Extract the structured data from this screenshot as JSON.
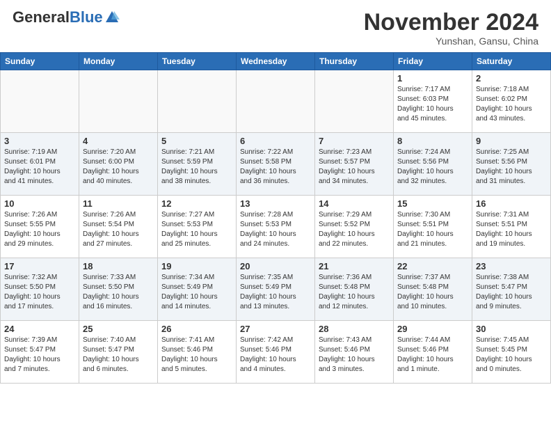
{
  "header": {
    "logo_general": "General",
    "logo_blue": "Blue",
    "month_title": "November 2024",
    "location": "Yunshan, Gansu, China"
  },
  "days_of_week": [
    "Sunday",
    "Monday",
    "Tuesday",
    "Wednesday",
    "Thursday",
    "Friday",
    "Saturday"
  ],
  "weeks": [
    {
      "shaded": false,
      "days": [
        {
          "date": "",
          "info": ""
        },
        {
          "date": "",
          "info": ""
        },
        {
          "date": "",
          "info": ""
        },
        {
          "date": "",
          "info": ""
        },
        {
          "date": "",
          "info": ""
        },
        {
          "date": "1",
          "info": "Sunrise: 7:17 AM\nSunset: 6:03 PM\nDaylight: 10 hours\nand 45 minutes."
        },
        {
          "date": "2",
          "info": "Sunrise: 7:18 AM\nSunset: 6:02 PM\nDaylight: 10 hours\nand 43 minutes."
        }
      ]
    },
    {
      "shaded": true,
      "days": [
        {
          "date": "3",
          "info": "Sunrise: 7:19 AM\nSunset: 6:01 PM\nDaylight: 10 hours\nand 41 minutes."
        },
        {
          "date": "4",
          "info": "Sunrise: 7:20 AM\nSunset: 6:00 PM\nDaylight: 10 hours\nand 40 minutes."
        },
        {
          "date": "5",
          "info": "Sunrise: 7:21 AM\nSunset: 5:59 PM\nDaylight: 10 hours\nand 38 minutes."
        },
        {
          "date": "6",
          "info": "Sunrise: 7:22 AM\nSunset: 5:58 PM\nDaylight: 10 hours\nand 36 minutes."
        },
        {
          "date": "7",
          "info": "Sunrise: 7:23 AM\nSunset: 5:57 PM\nDaylight: 10 hours\nand 34 minutes."
        },
        {
          "date": "8",
          "info": "Sunrise: 7:24 AM\nSunset: 5:56 PM\nDaylight: 10 hours\nand 32 minutes."
        },
        {
          "date": "9",
          "info": "Sunrise: 7:25 AM\nSunset: 5:56 PM\nDaylight: 10 hours\nand 31 minutes."
        }
      ]
    },
    {
      "shaded": false,
      "days": [
        {
          "date": "10",
          "info": "Sunrise: 7:26 AM\nSunset: 5:55 PM\nDaylight: 10 hours\nand 29 minutes."
        },
        {
          "date": "11",
          "info": "Sunrise: 7:26 AM\nSunset: 5:54 PM\nDaylight: 10 hours\nand 27 minutes."
        },
        {
          "date": "12",
          "info": "Sunrise: 7:27 AM\nSunset: 5:53 PM\nDaylight: 10 hours\nand 25 minutes."
        },
        {
          "date": "13",
          "info": "Sunrise: 7:28 AM\nSunset: 5:53 PM\nDaylight: 10 hours\nand 24 minutes."
        },
        {
          "date": "14",
          "info": "Sunrise: 7:29 AM\nSunset: 5:52 PM\nDaylight: 10 hours\nand 22 minutes."
        },
        {
          "date": "15",
          "info": "Sunrise: 7:30 AM\nSunset: 5:51 PM\nDaylight: 10 hours\nand 21 minutes."
        },
        {
          "date": "16",
          "info": "Sunrise: 7:31 AM\nSunset: 5:51 PM\nDaylight: 10 hours\nand 19 minutes."
        }
      ]
    },
    {
      "shaded": true,
      "days": [
        {
          "date": "17",
          "info": "Sunrise: 7:32 AM\nSunset: 5:50 PM\nDaylight: 10 hours\nand 17 minutes."
        },
        {
          "date": "18",
          "info": "Sunrise: 7:33 AM\nSunset: 5:50 PM\nDaylight: 10 hours\nand 16 minutes."
        },
        {
          "date": "19",
          "info": "Sunrise: 7:34 AM\nSunset: 5:49 PM\nDaylight: 10 hours\nand 14 minutes."
        },
        {
          "date": "20",
          "info": "Sunrise: 7:35 AM\nSunset: 5:49 PM\nDaylight: 10 hours\nand 13 minutes."
        },
        {
          "date": "21",
          "info": "Sunrise: 7:36 AM\nSunset: 5:48 PM\nDaylight: 10 hours\nand 12 minutes."
        },
        {
          "date": "22",
          "info": "Sunrise: 7:37 AM\nSunset: 5:48 PM\nDaylight: 10 hours\nand 10 minutes."
        },
        {
          "date": "23",
          "info": "Sunrise: 7:38 AM\nSunset: 5:47 PM\nDaylight: 10 hours\nand 9 minutes."
        }
      ]
    },
    {
      "shaded": false,
      "days": [
        {
          "date": "24",
          "info": "Sunrise: 7:39 AM\nSunset: 5:47 PM\nDaylight: 10 hours\nand 7 minutes."
        },
        {
          "date": "25",
          "info": "Sunrise: 7:40 AM\nSunset: 5:47 PM\nDaylight: 10 hours\nand 6 minutes."
        },
        {
          "date": "26",
          "info": "Sunrise: 7:41 AM\nSunset: 5:46 PM\nDaylight: 10 hours\nand 5 minutes."
        },
        {
          "date": "27",
          "info": "Sunrise: 7:42 AM\nSunset: 5:46 PM\nDaylight: 10 hours\nand 4 minutes."
        },
        {
          "date": "28",
          "info": "Sunrise: 7:43 AM\nSunset: 5:46 PM\nDaylight: 10 hours\nand 3 minutes."
        },
        {
          "date": "29",
          "info": "Sunrise: 7:44 AM\nSunset: 5:46 PM\nDaylight: 10 hours\nand 1 minute."
        },
        {
          "date": "30",
          "info": "Sunrise: 7:45 AM\nSunset: 5:45 PM\nDaylight: 10 hours\nand 0 minutes."
        }
      ]
    }
  ]
}
